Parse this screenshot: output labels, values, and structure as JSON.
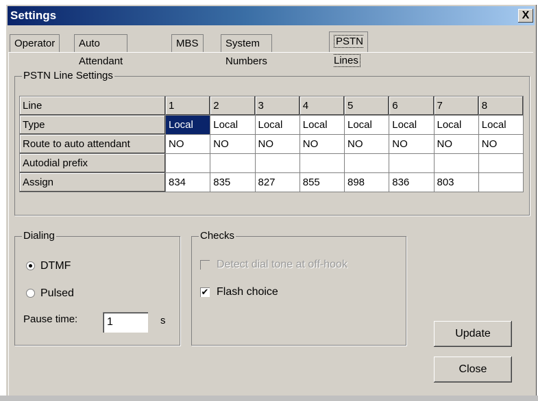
{
  "window": {
    "title": "Settings",
    "close_label": "X"
  },
  "tabs": [
    {
      "label": "Operator"
    },
    {
      "label": "Auto Attendant"
    },
    {
      "label": "MBS"
    },
    {
      "label": "System Numbers"
    },
    {
      "label": "PSTN Lines",
      "active": true
    }
  ],
  "pstn": {
    "legend": "PSTN Line Settings",
    "rows": [
      {
        "header": "Line",
        "cells": [
          "1",
          "2",
          "3",
          "4",
          "5",
          "6",
          "7",
          "8"
        ]
      },
      {
        "header": "Type",
        "cells": [
          "Local",
          "Local",
          "Local",
          "Local",
          "Local",
          "Local",
          "Local",
          "Local"
        ]
      },
      {
        "header": "Route to auto attendant",
        "cells": [
          "NO",
          "NO",
          "NO",
          "NO",
          "NO",
          "NO",
          "NO",
          "NO"
        ]
      },
      {
        "header": "Autodial prefix",
        "cells": [
          "",
          "",
          "",
          "",
          "",
          "",
          "",
          ""
        ]
      },
      {
        "header": "Assign",
        "cells": [
          "834",
          "835",
          "827",
          "855",
          "898",
          "836",
          "803",
          ""
        ]
      }
    ]
  },
  "dialing": {
    "legend": "Dialing",
    "dtmf_label": "DTMF",
    "pulsed_label": "Pulsed",
    "selected": "DTMF",
    "pause_label": "Pause time:",
    "pause_value": "1",
    "pause_unit": "s"
  },
  "checks": {
    "legend": "Checks",
    "detect_label": "Detect dial tone at off-hook",
    "detect_checked": false,
    "flash_label": "Flash choice",
    "flash_checked": true
  },
  "buttons": {
    "update": "Update",
    "close": "Close"
  },
  "colors": {
    "title_start": "#0a246a",
    "selection": "#0a246a",
    "face": "#d4d0c8"
  }
}
